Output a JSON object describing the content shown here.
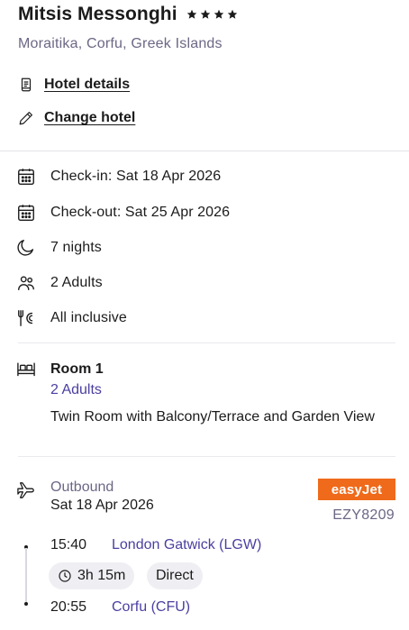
{
  "hotel": {
    "name": "Mitsis Messonghi",
    "star_rating": 4,
    "location": "Moraitika, Corfu, Greek Islands"
  },
  "links": {
    "hotel_details": "Hotel details",
    "change_hotel": "Change hotel"
  },
  "stay": {
    "check_in": "Check-in: Sat 18 Apr 2026",
    "check_out": "Check-out: Sat 25 Apr 2026",
    "nights": "7 nights",
    "guests": "2 Adults",
    "board": "All inclusive"
  },
  "room": {
    "title": "Room 1",
    "occupancy": "2 Adults",
    "type": "Twin Room with Balcony/Terrace and Garden View"
  },
  "flight": {
    "direction": "Outbound",
    "date": "Sat 18 Apr 2026",
    "carrier": "easyJet",
    "number": "EZY8209",
    "departure_time": "15:40",
    "departure_airport": "London Gatwick (LGW)",
    "duration": "3h 15m",
    "stops": "Direct",
    "arrival_time": "20:55",
    "arrival_airport": "Corfu (CFU)"
  },
  "colors": {
    "accent_text": "#4a3fa0",
    "muted_text": "#6c6785",
    "carrier_brand": "#ef6a1a"
  },
  "icons": [
    "star-icon",
    "document-icon",
    "pencil-icon",
    "calendar-icon",
    "moon-icon",
    "people-icon",
    "dining-icon",
    "bed-icon",
    "plane-icon",
    "clock-icon"
  ]
}
